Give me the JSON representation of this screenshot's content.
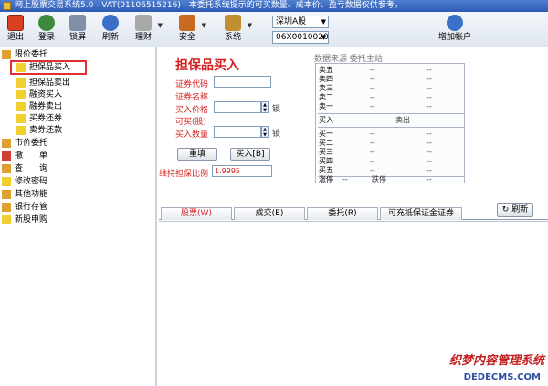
{
  "window": {
    "title": "网上股票交易系统5.0 - VAT(01106515216) - 本委托系统提示的可买数量、成本价、盈亏数据仅供参考。"
  },
  "toolbar": {
    "buttons": [
      {
        "label": "退出",
        "icon": "power-icon"
      },
      {
        "label": "登录",
        "icon": "login-users-icon"
      },
      {
        "label": "锁屏",
        "icon": "lock-screen-icon"
      },
      {
        "label": "刷新",
        "icon": "refresh-icon"
      },
      {
        "label": "理财",
        "icon": "finance-icon"
      },
      {
        "label": "安全",
        "icon": "shield-icon"
      },
      {
        "label": "系统",
        "icon": "tools-icon"
      }
    ],
    "market_select": "深圳A股",
    "account_select": "06X0010020",
    "add_account": "增加帐户"
  },
  "sidebar": {
    "items": [
      "限价委托",
      "担保品买入",
      "担保品卖出",
      "融资买入",
      "融券卖出",
      "买券还券",
      "卖券还款",
      "市价委托",
      "撤　　单",
      "查　　询",
      "修改密码",
      "其他功能",
      "银行存管",
      "新股申购"
    ]
  },
  "form": {
    "title": "担保品买入",
    "code_label": "证券代码",
    "name_label": "证券名称",
    "price_label": "买入价格",
    "lock_label": "锁",
    "can_buy_label": "可买(股)",
    "qty_label": "买入数量",
    "reset_button": "重填",
    "buy_button": "买入[B]",
    "ratio_label": "维持担保比例",
    "ratio_value": "1.9995"
  },
  "quote": {
    "header": "数据来源 委托主站",
    "sell_rows": [
      "卖五",
      "卖四",
      "卖三",
      "卖二",
      "卖一"
    ],
    "dash": "--",
    "buy_label": "买入",
    "sell_label": "卖出",
    "buy_rows": [
      "买一",
      "买二",
      "买三",
      "买四",
      "买五"
    ],
    "limit_up": "涨停",
    "limit_down": "跌停"
  },
  "tabs": [
    "股票(W)",
    "成交(E)",
    "委托(R)",
    "可充抵保证金证券"
  ],
  "refresh_button": "刷新",
  "watermark": {
    "line1": "织梦内容管理系统",
    "line2": "DEDECMS.COM"
  }
}
